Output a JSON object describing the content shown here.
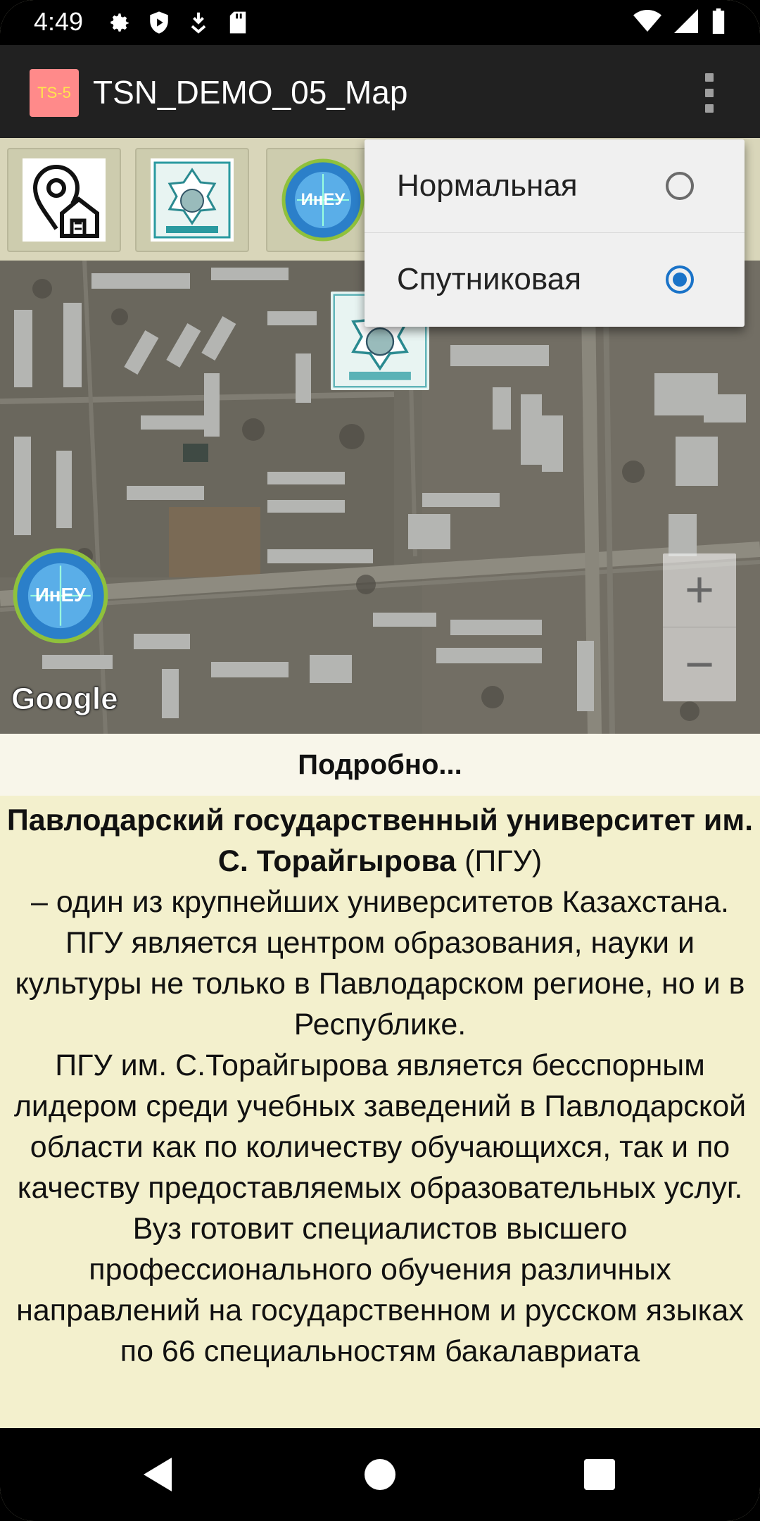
{
  "status_bar": {
    "time": "4:49",
    "icons_left": [
      "gear-icon",
      "shield-icon",
      "download-icon",
      "sd-card-icon"
    ],
    "icons_right": [
      "wifi-icon",
      "signal-icon",
      "battery-icon"
    ]
  },
  "app_bar": {
    "icon_text": "TS-5",
    "title": "TSN_DEMO_05_Map"
  },
  "marker_toolbar": {
    "buttons": [
      "location-home-icon",
      "university-emblem-icon",
      "ineu-logo-icon"
    ]
  },
  "popup_menu": {
    "items": [
      {
        "label": "Нормальная",
        "checked": false
      },
      {
        "label": "Спутниковая",
        "checked": true
      }
    ]
  },
  "map": {
    "attribution": "Google",
    "zoom_in": "+",
    "zoom_out": "−"
  },
  "details": {
    "header": "Подробно...",
    "university_name": "Павлодарский государственный университет им. С. Торайгырова",
    "university_abbr": "(ПГУ)",
    "lines": [
      "– один из крупнейших университетов Казахстана.",
      "ПГУ является центром образования, науки и культуры не только в Павлодарском регионе, но и в Республике.",
      "ПГУ им. С.Торайгырова является бесспорным лидером среди учебных заведений в Павлодарской области как по количеству обучающихся, так и по качеству предоставляемых образовательных услуг.",
      "Вуз готовит специалистов высшего профессионального обучения различных направлений на государственном и русском языках по 66 специальностям бакалавриата"
    ]
  },
  "colors": {
    "app_bar": "#212121",
    "details_bg": "#f3f0cd",
    "radio_checked": "#1a73c8",
    "app_icon_bg": "#ff8a8a"
  }
}
